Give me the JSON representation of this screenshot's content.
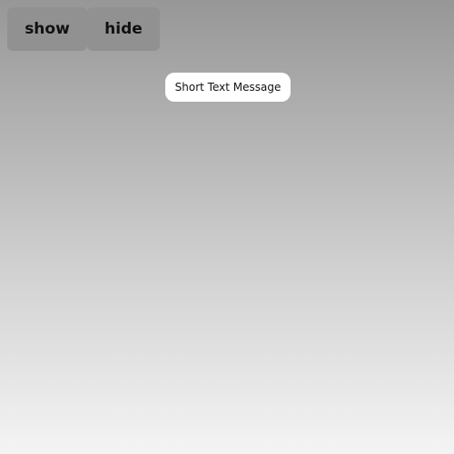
{
  "controls": {
    "show_label": "show",
    "hide_label": "hide"
  },
  "toast": {
    "message": "Short Text Message"
  }
}
